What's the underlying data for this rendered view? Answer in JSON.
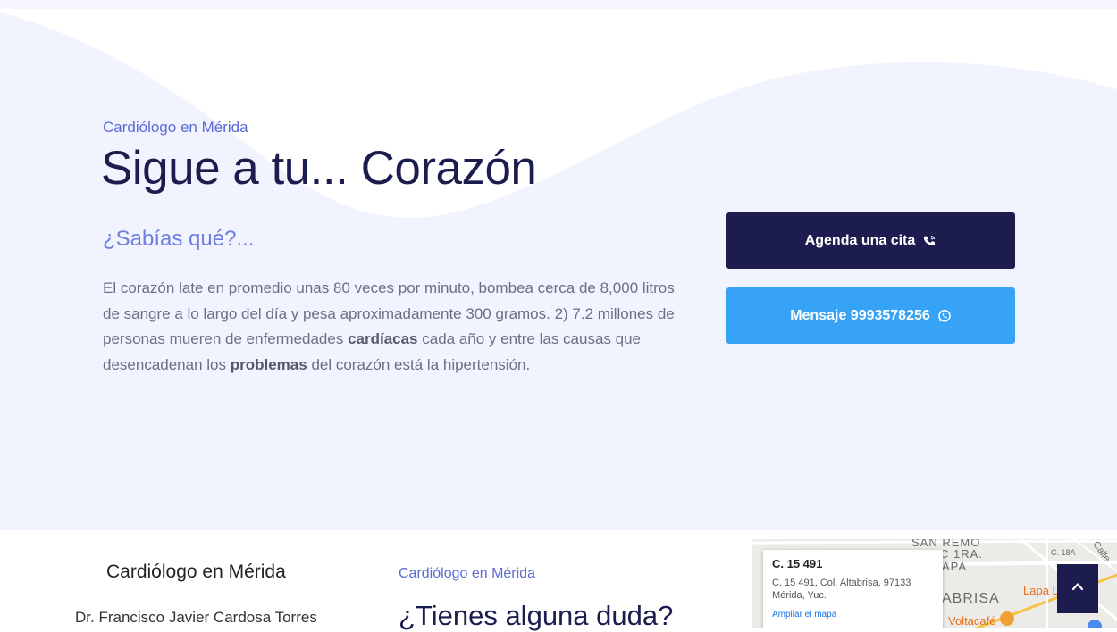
{
  "hero": {
    "eyebrow": "Cardiólogo en Mérida",
    "title": "Sigue a tu... Corazón",
    "subtitle": "¿Sabías qué?...",
    "paragraph": {
      "p1": "El corazón late en promedio unas 80 veces por minuto, bombea cerca de 8,000 litros de sangre a lo largo del día y pesa aproximadamente 300 gramos. 2) 7.2 millones de personas mueren de enfermedades ",
      "b1": "cardíacas",
      "p2": " cada año y entre las causas que desencadenan los ",
      "b2": "problemas",
      "p3": " del corazón está la hipertensión."
    },
    "buttons": {
      "appointment": {
        "label": "Agenda una cita",
        "icon": "phone-icon"
      },
      "message": {
        "label": "Mensaje 9993578256",
        "icon": "whatsapp-icon"
      }
    }
  },
  "footer": {
    "col1": {
      "title": "Cardiólogo en Mérida",
      "name": "Dr. Francisco Javier Cardosa Torres"
    },
    "col2": {
      "eyebrow": "Cardiólogo en Mérida",
      "title": "¿Tienes alguna duda?"
    },
    "map": {
      "card_title": "C. 15 491",
      "card_address": "C. 15 491, Col. Altabrisa, 97133 Mérida, Yuc.",
      "card_link": "Ampliar el mapa",
      "labels": [
        "SAN REMO",
        "C 1RA.",
        "APA",
        "ABRISA",
        "Voltacafé",
        "Lapa L",
        "C. 18A",
        "Calle"
      ]
    }
  },
  "colors": {
    "navy": "#1c1c4f",
    "blue": "#36a3f7",
    "accent": "#5b6bd6",
    "hero_bg": "#f1f3fe"
  },
  "scroll_top": {
    "icon": "chevron-up-icon"
  }
}
